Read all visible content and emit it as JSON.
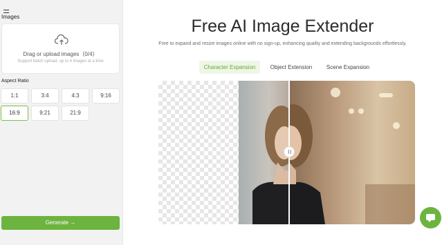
{
  "sidebar": {
    "images_label": "Images",
    "upload": {
      "title": "Drag or upload images（0/4）",
      "hint": "Support batch upload, up to 4 images at a time"
    },
    "aspect_ratio_label": "Aspect Ratio",
    "ratios": [
      "1:1",
      "3:4",
      "4:3",
      "9:16",
      "16:9",
      "9:21",
      "21:9"
    ],
    "selected_ratio": "16:9",
    "generate_label": "Generate →"
  },
  "main": {
    "title": "Free AI Image Extender",
    "subtitle": "Free to expand and resize images online with no sign-up, enhancing quality and extending backgrounds effortlessly.",
    "tabs": [
      {
        "label": "Character Expansion",
        "active": true
      },
      {
        "label": "Object Extension",
        "active": false
      },
      {
        "label": "Scene Expansion",
        "active": false
      }
    ]
  },
  "colors": {
    "accent": "#6cb43f",
    "active_tab_bg": "#eef6e6",
    "sidebar_bg": "#f2f2f2"
  },
  "icons": [
    "menu-icon",
    "upload-cloud-icon",
    "arrow-right-icon",
    "chat-icon",
    "divider-handle-icon"
  ]
}
